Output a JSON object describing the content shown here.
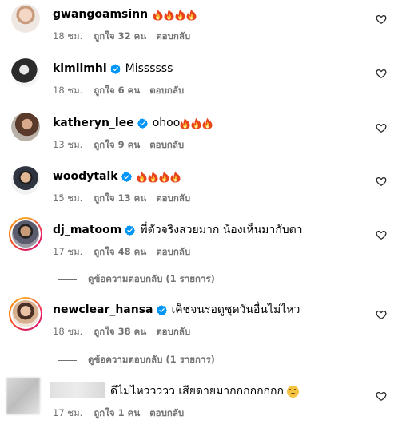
{
  "comments": [
    {
      "username": "gwangoamsinn",
      "verified": false,
      "text": "",
      "fires": 4,
      "time": "18 ชม.",
      "likes": "ถูกใจ 32 คน",
      "reply": "ตอบกลับ"
    },
    {
      "username": "kimlimhl",
      "verified": true,
      "text": "Missssss",
      "fires": 0,
      "time": "18 ชม.",
      "likes": "ถูกใจ 6 คน",
      "reply": "ตอบกลับ"
    },
    {
      "username": "katheryn_lee",
      "verified": true,
      "text": "ohoo",
      "fires": 3,
      "time": "13 ชม.",
      "likes": "ถูกใจ 9 คน",
      "reply": "ตอบกลับ"
    },
    {
      "username": "woodytalk",
      "verified": true,
      "text": "",
      "fires": 4,
      "time": "15 ชม.",
      "likes": "ถูกใจ 13 คน",
      "reply": "ตอบกลับ"
    },
    {
      "username": "dj_matoom",
      "verified": true,
      "text": "พี่ตัวจริงสวยมาก น้องเห็นมากับตา",
      "fires": 0,
      "time": "17 ชม.",
      "likes": "ถูกใจ 48 คน",
      "reply": "ตอบกลับ",
      "view_replies": "ดูข้อความตอบกลับ (1 รายการ)"
    },
    {
      "username": "newclear_hansa",
      "verified": true,
      "text": "เค็ชจนรอดูชุดวันอื่นไม่ไหว",
      "fires": 0,
      "time": "18 ชม.",
      "likes": "ถูกใจ 38 คน",
      "reply": "ตอบกลับ",
      "view_replies": "ดูข้อความตอบกลับ (1 รายการ)"
    },
    {
      "username": "",
      "verified": false,
      "text": "ดีไม่ไหววววว เสียดายมากกกกกกกก",
      "emoji": "☹",
      "fires": 0,
      "time": "17 ชม.",
      "likes": "ถูกใจ 1 คน",
      "reply": "ตอบกลับ"
    }
  ],
  "icons": {
    "heart": "heart-outline-icon",
    "verified": "verified-badge-icon",
    "fire": "fire-emoji"
  },
  "colors": {
    "verified": "#0095f6",
    "meta": "#737373",
    "ring_start": "#f9a825",
    "ring_end": "#d81b60"
  }
}
